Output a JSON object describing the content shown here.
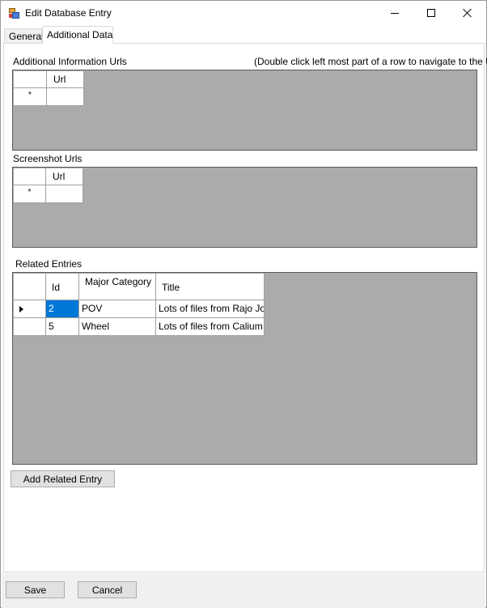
{
  "window": {
    "title": "Edit Database Entry"
  },
  "tabs": [
    {
      "label": "General"
    },
    {
      "label": "Additional Data"
    }
  ],
  "info_urls": {
    "label": "Additional Information Urls",
    "hint": "(Double click left most part of a row to navigate to the Url)",
    "column": "Url",
    "new_row_marker": "*"
  },
  "screenshot_urls": {
    "label": "Screenshot Urls",
    "column": "Url",
    "new_row_marker": "*"
  },
  "related": {
    "label": "Related Entries",
    "columns": [
      "Id",
      "Major Category",
      "Title"
    ],
    "rows": [
      {
        "id": "2",
        "category": "POV",
        "title": "Lots of files from Rajo Joey"
      },
      {
        "id": "5",
        "category": "Wheel",
        "title": "Lots of files from Calium"
      }
    ],
    "add_button": "Add Related Entry"
  },
  "footer": {
    "save": "Save",
    "cancel": "Cancel"
  }
}
